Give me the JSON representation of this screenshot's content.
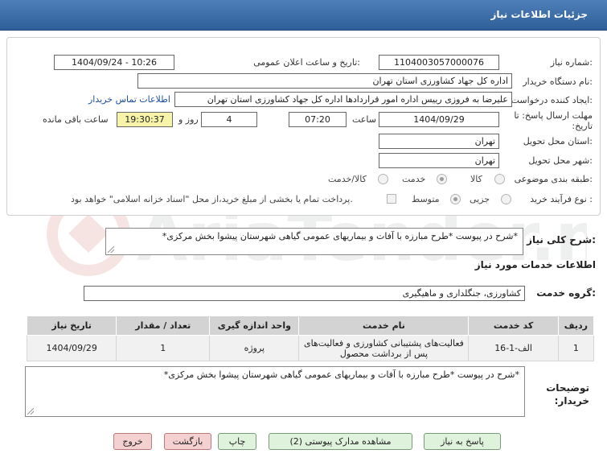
{
  "header": {
    "title": "جزئیات اطلاعات نیاز"
  },
  "form": {
    "need_number_label": "شماره نیاز:",
    "need_number": "1104003057000076",
    "announce_label": "تاریخ و ساعت اعلان عمومی:",
    "announce_value": "1404/09/24 - 10:26",
    "buyer_org_label": "نام دستگاه خریدار:",
    "buyer_org": "اداره کل جهاد کشاورزی استان تهران",
    "creator_label": "ایجاد کننده درخواست:",
    "creator": "علیرضا به فروزی رییس اداره امور قراردادها اداره کل جهاد کشاورزی استان تهران",
    "contact_link": "اطلاعات تماس خریدار",
    "deadline_label": "مهلت ارسال پاسخ: تا تاریخ:",
    "deadline_date": "1404/09/29",
    "time_label": "ساعت",
    "deadline_time": "07:20",
    "days": "4",
    "days_label": "روز و",
    "remaining": "19:30:37",
    "remaining_label": "ساعت باقی مانده",
    "province_label": "استان محل تحویل:",
    "province": "تهران",
    "city_label": "شهر محل تحویل:",
    "city": "تهران",
    "category_label": "طبقه بندی موضوعی:",
    "category_options": [
      "کالا",
      "خدمت",
      "کالا/خدمت"
    ],
    "process_label": "نوع فرآیند خرید :",
    "process_options": [
      "جزیی",
      "متوسط"
    ],
    "treasury_note": "پرداخت تمام یا بخشی از مبلغ خرید،از محل \"اسناد خزانه اسلامی\" خواهد بود."
  },
  "summary": {
    "label": "شرح کلی نیاز:",
    "text": "*شرح در پیوست *طرح مبارزه با آفات و بیماریهای عمومی گیاهی شهرستان  پیشوا بخش مرکزی*"
  },
  "services": {
    "section_title": "اطلاعات خدمات مورد نیاز",
    "group_label": "گروه خدمت:",
    "group_value": "کشاورزی، جنگلداری و ماهیگیری",
    "columns": [
      "ردیف",
      "کد خدمت",
      "نام خدمت",
      "واحد اندازه گیری",
      "تعداد / مقدار",
      "تاریخ نیاز"
    ],
    "rows": [
      [
        "1",
        "الف-1-16",
        "فعالیت‌های پشتیبانی کشاورزی و فعالیت‌های پس از برداشت محصول",
        "پروژه",
        "1",
        "1404/09/29"
      ]
    ]
  },
  "buyer_notes": {
    "label": "توضیحات خریدار:",
    "text": "*شرح در پیوست *طرح مبارزه با آفات و بیماریهای عمومی گیاهی شهرستان  پیشوا بخش مرکزی*"
  },
  "buttons": {
    "reply": "پاسخ به نیاز",
    "attachments": "مشاهده مدارک پیوستی (2)",
    "print": "چاپ",
    "back": "بازگشت",
    "exit": "خروج"
  },
  "watermark": "AriaTender.neT",
  "colors": {
    "header": "#2f5f99",
    "remaining_bg": "#f7f3a8",
    "button_green": "#dff2dc",
    "button_red": "#f5d0d0"
  }
}
